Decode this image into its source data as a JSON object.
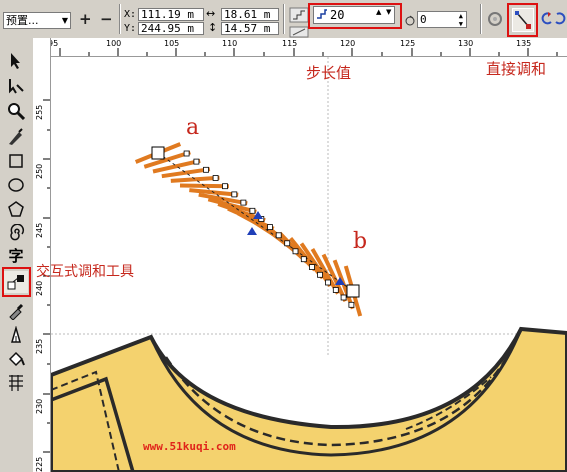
{
  "property_bar": {
    "preset_value": "预置...",
    "x_label": "X:",
    "x_value": "111.19 m",
    "y_label": "Y:",
    "y_value": "244.95 m",
    "width_value": "18.61 m",
    "height_value": "14.57 m",
    "steps_value": "20",
    "rotation_value": "0",
    "add_label": "+",
    "remove_label": "−"
  },
  "ruler": {
    "h_ticks": [
      "95",
      "100",
      "105",
      "110",
      "115",
      "120",
      "125",
      "130",
      "135"
    ],
    "v_ticks": [
      "255",
      "250",
      "245",
      "240",
      "235",
      "230",
      "225"
    ]
  },
  "annotations": {
    "steps_note": "步长值",
    "direct_blend_note": "直接调和",
    "tool_note": "交互式调和工具",
    "point_a": "a",
    "point_b": "b",
    "watermark": "www.51kuqi.com"
  },
  "blend": {
    "steps": 20,
    "color": "#e07a20"
  },
  "colors": {
    "annotation_red": "#c6281d",
    "shirt_fill": "#f4d26e",
    "shirt_stroke": "#2a2a2a",
    "highlight_box": "#dd1111"
  },
  "tools": [
    "pick-tool-icon",
    "shape-tool-icon",
    "zoom-tool-icon",
    "freehand-tool-icon",
    "rectangle-tool-icon",
    "ellipse-tool-icon",
    "polygon-tool-icon",
    "spiral-tool-icon",
    "text-tool-icon",
    "interactive-blend-tool-icon",
    "eyedropper-tool-icon",
    "outline-tool-icon",
    "fill-tool-icon",
    "interactive-fill-tool-icon"
  ]
}
